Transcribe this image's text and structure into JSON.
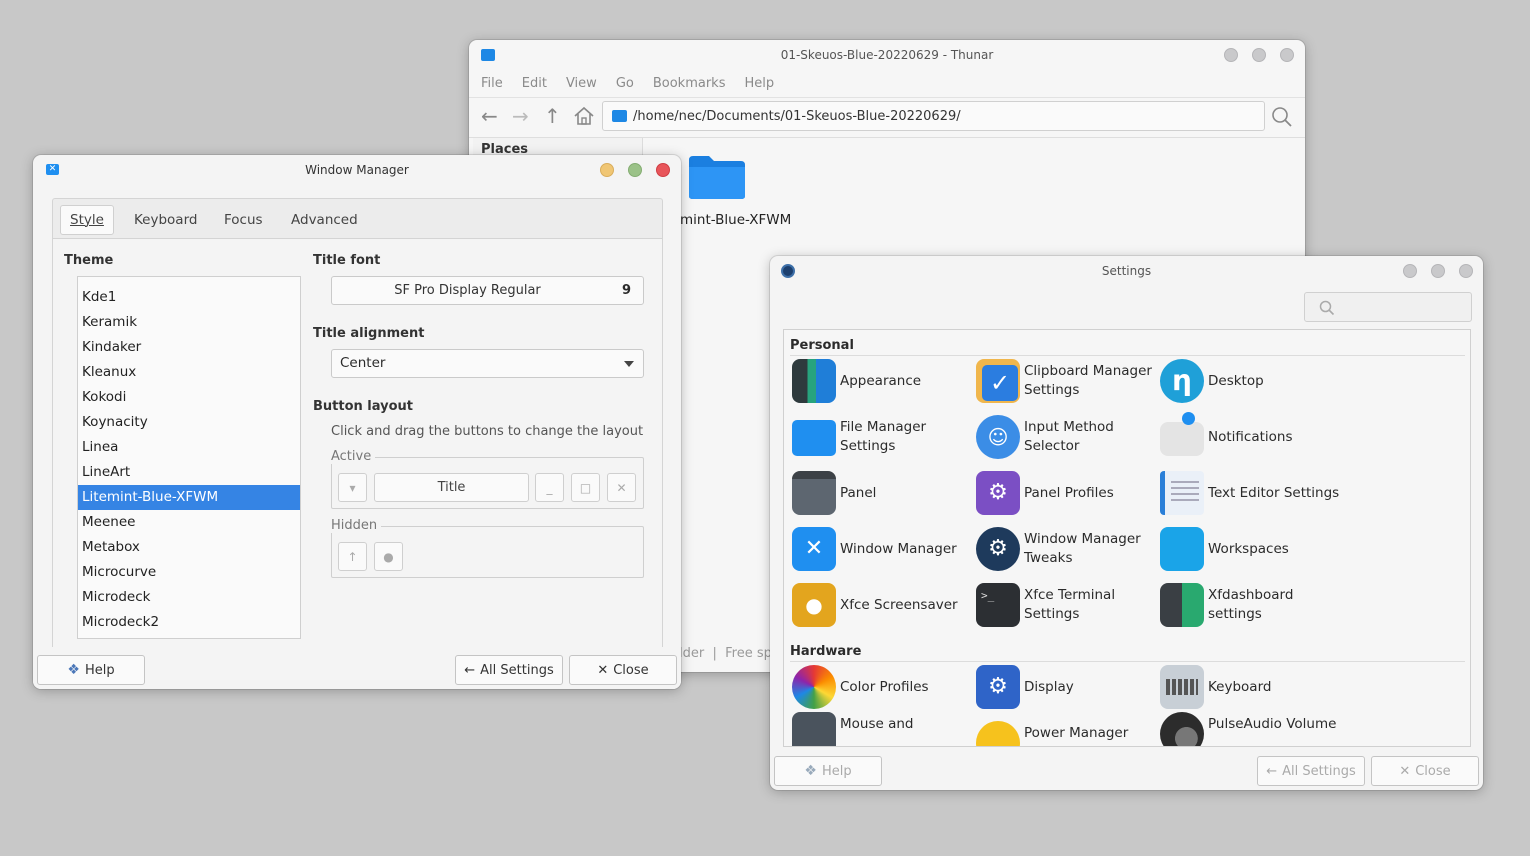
{
  "thunar": {
    "title": "01-Skeuos-Blue-20220629 - Thunar",
    "menu": [
      "File",
      "Edit",
      "View",
      "Go",
      "Bookmarks",
      "Help"
    ],
    "path": "/home/nec/Documents/01-Skeuos-Blue-20220629/",
    "places_label": "Places",
    "folder_label": "mint-Blue-XFWM",
    "status_text": "lder  |  Free sp"
  },
  "wm": {
    "title": "Window Manager",
    "tabs": [
      "Style",
      "Keyboard",
      "Focus",
      "Advanced"
    ],
    "theme_label": "Theme",
    "themes": [
      "Kde1",
      "Keramik",
      "Kindaker",
      "Kleanux",
      "Kokodi",
      "Koynacity",
      "Linea",
      "LineArt",
      "Litemint-Blue-XFWM",
      "Meenee",
      "Metabox",
      "Microcurve",
      "Microdeck",
      "Microdeck2"
    ],
    "selected_theme": "Litemint-Blue-XFWM",
    "title_font_label": "Title font",
    "title_font_value": "SF Pro Display Regular",
    "title_font_size": "9",
    "title_alignment_label": "Title alignment",
    "title_alignment_value": "Center",
    "button_layout_label": "Button layout",
    "button_layout_hint": "Click and drag the buttons to change the layout",
    "active_label": "Active",
    "active_title_button": "Title",
    "hidden_label": "Hidden",
    "help": "Help",
    "all_settings": "All Settings",
    "close": "Close"
  },
  "settings": {
    "title": "Settings",
    "search_placeholder": "",
    "categories": [
      {
        "name": "Personal",
        "items": [
          {
            "label": "Appearance",
            "icon": "appearance-icon"
          },
          {
            "label": "Clipboard Manager Settings",
            "icon": "clipboard-icon"
          },
          {
            "label": "Desktop",
            "icon": "desktop-icon"
          },
          {
            "label": "File Manager Settings",
            "icon": "folder-icon"
          },
          {
            "label": "Input Method Selector",
            "icon": "input-method-icon"
          },
          {
            "label": "Notifications",
            "icon": "notifications-icon"
          },
          {
            "label": "Panel",
            "icon": "panel-icon"
          },
          {
            "label": "Panel Profiles",
            "icon": "panel-profiles-icon"
          },
          {
            "label": "Text Editor Settings",
            "icon": "text-editor-icon"
          },
          {
            "label": "Window Manager",
            "icon": "window-manager-icon"
          },
          {
            "label": "Window Manager Tweaks",
            "icon": "wm-tweaks-icon"
          },
          {
            "label": "Workspaces",
            "icon": "workspaces-icon"
          },
          {
            "label": "Xfce Screensaver",
            "icon": "screensaver-icon"
          },
          {
            "label": "Xfce Terminal Settings",
            "icon": "terminal-icon"
          },
          {
            "label": "Xfdashboard settings",
            "icon": "xfdashboard-icon"
          }
        ]
      },
      {
        "name": "Hardware",
        "items": [
          {
            "label": "Color Profiles",
            "icon": "color-profiles-icon"
          },
          {
            "label": "Display",
            "icon": "display-icon"
          },
          {
            "label": "Keyboard",
            "icon": "keyboard-icon"
          },
          {
            "label": "Mouse and",
            "icon": "mouse-icon"
          },
          {
            "label": "Power Manager",
            "icon": "power-icon"
          },
          {
            "label": "PulseAudio Volume",
            "icon": "speaker-icon"
          }
        ]
      }
    ],
    "help": "Help",
    "all_settings": "All Settings",
    "close": "Close"
  }
}
